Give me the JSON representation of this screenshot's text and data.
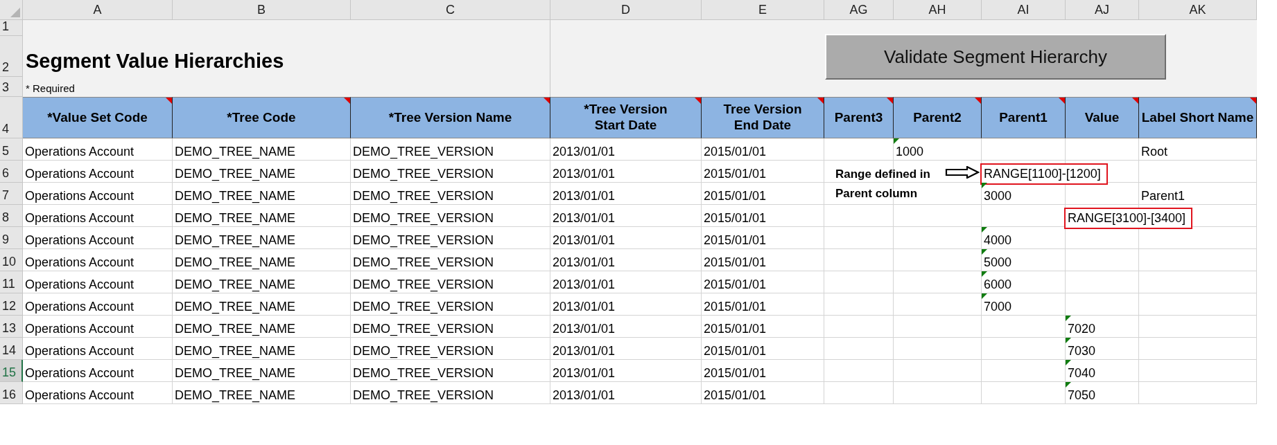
{
  "column_letters": [
    "A",
    "B",
    "C",
    "D",
    "E",
    "AG",
    "AH",
    "AI",
    "AJ",
    "AK"
  ],
  "top_rows": [
    {
      "number": "1",
      "selected": false
    },
    {
      "number": "2",
      "selected": false
    },
    {
      "number": "3",
      "selected": false
    }
  ],
  "title": "Segment Value Hierarchies",
  "required_note": "* Required",
  "validate_button": "Validate Segment Hierarchy",
  "header_row": {
    "number": "4",
    "selected": false,
    "cells": [
      {
        "text": "*Value Set Code",
        "comment": true
      },
      {
        "text": "*Tree Code",
        "comment": true
      },
      {
        "text": "*Tree Version Name",
        "comment": true
      },
      {
        "text": "*Tree Version Start Date",
        "comment": true
      },
      {
        "text": "Tree Version End Date",
        "comment": true
      },
      {
        "text": "Parent3",
        "comment": true
      },
      {
        "text": "Parent2",
        "comment": true
      },
      {
        "text": "Parent1",
        "comment": true
      },
      {
        "text": "Value",
        "comment": true
      },
      {
        "text": "Label Short Name",
        "comment": true
      }
    ]
  },
  "rows": [
    {
      "number": "5",
      "selected": false,
      "value_set_code": "Operations Account",
      "tree_code": "DEMO_TREE_NAME",
      "tree_version_name": "DEMO_TREE_VERSION",
      "start_date": "2013/01/01",
      "end_date": "2015/01/01",
      "parent2": {
        "text": "1000",
        "flagged": true,
        "highlighted": false
      },
      "label_short_name": {
        "text": "Root",
        "flagged": false,
        "highlighted": false
      }
    },
    {
      "number": "6",
      "selected": false,
      "value_set_code": "Operations Account",
      "tree_code": "DEMO_TREE_NAME",
      "tree_version_name": "DEMO_TREE_VERSION",
      "start_date": "2013/01/01",
      "end_date": "2015/01/01",
      "parent1": {
        "text": "RANGE[1100]-[1200]",
        "flagged": false,
        "highlighted": true
      }
    },
    {
      "number": "7",
      "selected": false,
      "value_set_code": "Operations Account",
      "tree_code": "DEMO_TREE_NAME",
      "tree_version_name": "DEMO_TREE_VERSION",
      "start_date": "2013/01/01",
      "end_date": "2015/01/01",
      "parent1": {
        "text": "3000",
        "flagged": true,
        "highlighted": false
      },
      "label_short_name": {
        "text": "Parent1",
        "flagged": false,
        "highlighted": false
      }
    },
    {
      "number": "8",
      "selected": false,
      "value_set_code": "Operations Account",
      "tree_code": "DEMO_TREE_NAME",
      "tree_version_name": "DEMO_TREE_VERSION",
      "start_date": "2013/01/01",
      "end_date": "2015/01/01",
      "value": {
        "text": "RANGE[3100]-[3400]",
        "flagged": false,
        "highlighted": true
      }
    },
    {
      "number": "9",
      "selected": false,
      "value_set_code": "Operations Account",
      "tree_code": "DEMO_TREE_NAME",
      "tree_version_name": "DEMO_TREE_VERSION",
      "start_date": "2013/01/01",
      "end_date": "2015/01/01",
      "parent1": {
        "text": "4000",
        "flagged": true,
        "highlighted": false
      }
    },
    {
      "number": "10",
      "selected": false,
      "value_set_code": "Operations Account",
      "tree_code": "DEMO_TREE_NAME",
      "tree_version_name": "DEMO_TREE_VERSION",
      "start_date": "2013/01/01",
      "end_date": "2015/01/01",
      "parent1": {
        "text": "5000",
        "flagged": true,
        "highlighted": false
      }
    },
    {
      "number": "11",
      "selected": false,
      "value_set_code": "Operations Account",
      "tree_code": "DEMO_TREE_NAME",
      "tree_version_name": "DEMO_TREE_VERSION",
      "start_date": "2013/01/01",
      "end_date": "2015/01/01",
      "parent1": {
        "text": "6000",
        "flagged": true,
        "highlighted": false
      }
    },
    {
      "number": "12",
      "selected": false,
      "value_set_code": "Operations Account",
      "tree_code": "DEMO_TREE_NAME",
      "tree_version_name": "DEMO_TREE_VERSION",
      "start_date": "2013/01/01",
      "end_date": "2015/01/01",
      "parent1": {
        "text": "7000",
        "flagged": true,
        "highlighted": false
      }
    },
    {
      "number": "13",
      "selected": false,
      "value_set_code": "Operations Account",
      "tree_code": "DEMO_TREE_NAME",
      "tree_version_name": "DEMO_TREE_VERSION",
      "start_date": "2013/01/01",
      "end_date": "2015/01/01",
      "value": {
        "text": "7020",
        "flagged": true,
        "highlighted": false
      }
    },
    {
      "number": "14",
      "selected": false,
      "value_set_code": "Operations Account",
      "tree_code": "DEMO_TREE_NAME",
      "tree_version_name": "DEMO_TREE_VERSION",
      "start_date": "2013/01/01",
      "end_date": "2015/01/01",
      "value": {
        "text": "7030",
        "flagged": true,
        "highlighted": false
      }
    },
    {
      "number": "15",
      "selected": true,
      "value_set_code": "Operations Account",
      "tree_code": "DEMO_TREE_NAME",
      "tree_version_name": "DEMO_TREE_VERSION",
      "start_date": "2013/01/01",
      "end_date": "2015/01/01",
      "value": {
        "text": "7040",
        "flagged": true,
        "highlighted": false
      }
    },
    {
      "number": "16",
      "selected": false,
      "value_set_code": "Operations Account",
      "tree_code": "DEMO_TREE_NAME",
      "tree_version_name": "DEMO_TREE_VERSION",
      "start_date": "2013/01/01",
      "end_date": "2015/01/01",
      "value": {
        "text": "7050",
        "flagged": true,
        "highlighted": false
      }
    }
  ],
  "annotation": {
    "lines": [
      "Range defined in",
      "Parent column"
    ]
  }
}
